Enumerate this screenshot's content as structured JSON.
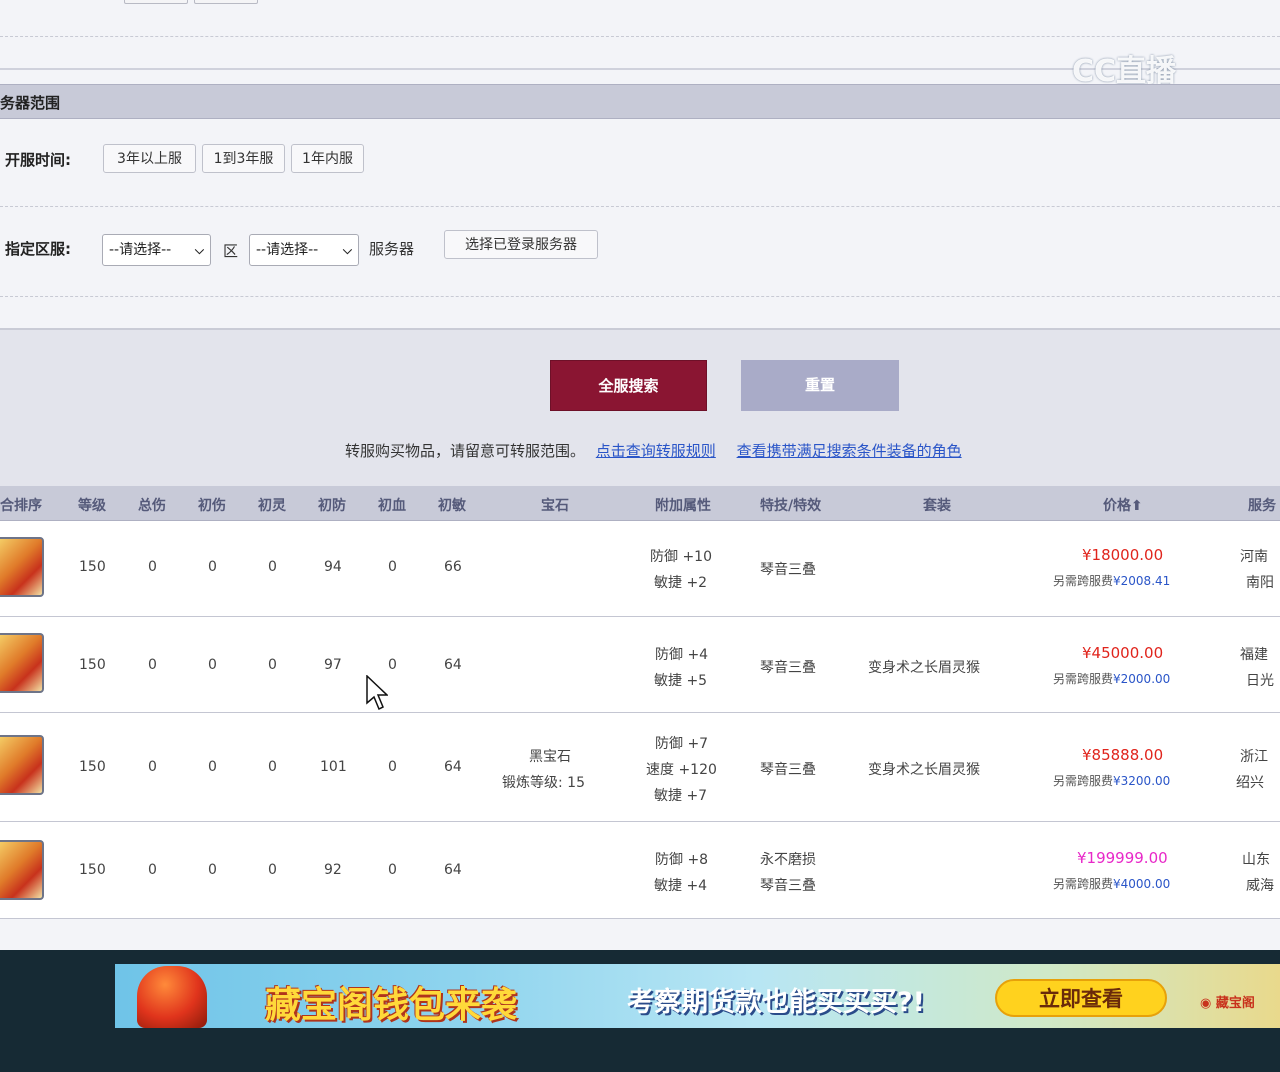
{
  "watermark": "CC直播",
  "section": {
    "title": "务器范围"
  },
  "open_time": {
    "label": "开服时间:",
    "options": [
      "3年以上服",
      "1到3年服",
      "1年内服"
    ]
  },
  "zone": {
    "label": "指定区服:",
    "area_select": "--请选择--",
    "area_suffix": "区",
    "server_select": "--请选择--",
    "server_suffix": "服务器",
    "choose_button": "选择已登录服务器"
  },
  "actions": {
    "search": "全服搜索",
    "reset": "重置"
  },
  "notice": {
    "text": "转服购买物品，请留意可转服范围。",
    "link1": "点击查询转服规则",
    "link2": "查看携带满足搜索条件装备的角色"
  },
  "table": {
    "headers": [
      "合排序",
      "等级",
      "总伤",
      "初伤",
      "初灵",
      "初防",
      "初血",
      "初敏",
      "宝石",
      "附加属性",
      "特技/特效",
      "套装",
      "价格⬆",
      "服务"
    ],
    "rows": [
      {
        "level": "150",
        "total_dmg": "0",
        "init_dmg": "0",
        "init_spirit": "0",
        "init_def": "94",
        "init_hp": "0",
        "init_agi": "66",
        "gem": [],
        "attrs": [
          "防御 +10",
          "敏捷 +2"
        ],
        "skills": [
          "琴音三叠"
        ],
        "set": "",
        "price": "¥18000.00",
        "fee_label": "另需跨服费",
        "fee": "¥2008.41",
        "server": [
          "河南",
          "南阳"
        ]
      },
      {
        "level": "150",
        "total_dmg": "0",
        "init_dmg": "0",
        "init_spirit": "0",
        "init_def": "97",
        "init_hp": "0",
        "init_agi": "64",
        "gem": [],
        "attrs": [
          "防御 +4",
          "敏捷 +5"
        ],
        "skills": [
          "琴音三叠"
        ],
        "set": "变身术之长眉灵猴",
        "price": "¥45000.00",
        "fee_label": "另需跨服费",
        "fee": "¥2000.00",
        "server": [
          "福建",
          "日光"
        ]
      },
      {
        "level": "150",
        "total_dmg": "0",
        "init_dmg": "0",
        "init_spirit": "0",
        "init_def": "101",
        "init_hp": "0",
        "init_agi": "64",
        "gem": [
          "黑宝石",
          "锻炼等级: 15"
        ],
        "attrs": [
          "防御 +7",
          "速度 +120",
          "敏捷 +7"
        ],
        "skills": [
          "琴音三叠"
        ],
        "set": "变身术之长眉灵猴",
        "price": "¥85888.00",
        "fee_label": "另需跨服费",
        "fee": "¥3200.00",
        "server": [
          "浙江",
          "绍兴"
        ]
      },
      {
        "level": "150",
        "total_dmg": "0",
        "init_dmg": "0",
        "init_spirit": "0",
        "init_def": "92",
        "init_hp": "0",
        "init_agi": "64",
        "gem": [],
        "attrs": [
          "防御 +8",
          "敏捷 +4"
        ],
        "skills": [
          "永不磨损",
          "琴音三叠"
        ],
        "set": "",
        "price": "¥199999.00",
        "fee_label": "另需跨服费",
        "fee": "¥4000.00",
        "server": [
          "山东",
          "威海"
        ]
      }
    ]
  },
  "banner": {
    "title": "藏宝阁钱包来袭",
    "subtitle": "考察期货款也能买买买?!",
    "button": "立即查看",
    "logo": "藏宝阁"
  },
  "colors": {
    "accent": "#8a1532",
    "link": "#2a55c8",
    "price": "#e0241c",
    "price_high": "#e828c8"
  }
}
